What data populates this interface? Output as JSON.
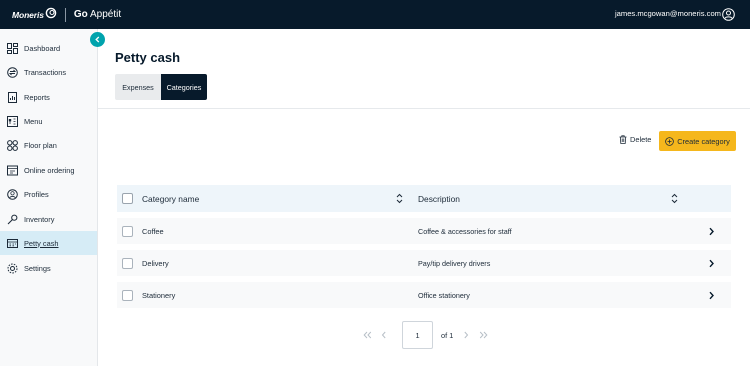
{
  "header": {
    "brand": "Moneris",
    "product_prefix": "Go",
    "product_name": "Appétit",
    "user_email": "james.mcgowan@moneris.com"
  },
  "sidebar": {
    "items": [
      {
        "label": "Dashboard",
        "icon": "dashboard-icon"
      },
      {
        "label": "Transactions",
        "icon": "transactions-icon"
      },
      {
        "label": "Reports",
        "icon": "reports-icon"
      },
      {
        "label": "Menu",
        "icon": "menu-icon"
      },
      {
        "label": "Floor plan",
        "icon": "floor-plan-icon"
      },
      {
        "label": "Online ordering",
        "icon": "online-ordering-icon"
      },
      {
        "label": "Profiles",
        "icon": "profiles-icon"
      },
      {
        "label": "Inventory",
        "icon": "inventory-icon"
      },
      {
        "label": "Petty cash",
        "icon": "petty-cash-icon",
        "active": true
      },
      {
        "label": "Settings",
        "icon": "settings-icon"
      }
    ]
  },
  "page": {
    "title": "Petty cash",
    "tabs": [
      {
        "label": "Expenses",
        "active": false
      },
      {
        "label": "Categories",
        "active": true
      }
    ]
  },
  "actions": {
    "delete_label": "Delete",
    "create_label": "Create category"
  },
  "table": {
    "columns": [
      "Category name",
      "Description"
    ],
    "rows": [
      {
        "name": "Coffee",
        "description": "Coffee & accessories for staff"
      },
      {
        "name": "Delivery",
        "description": "Pay/tip delivery drivers"
      },
      {
        "name": "Stationery",
        "description": "Office stationery"
      }
    ]
  },
  "pagination": {
    "current_page": "1",
    "of_label": "of 1"
  },
  "colors": {
    "topbar": "#071a2b",
    "accent": "#00a3ad",
    "primary_button": "#f5b71c",
    "active_nav": "#d6ecf6"
  }
}
